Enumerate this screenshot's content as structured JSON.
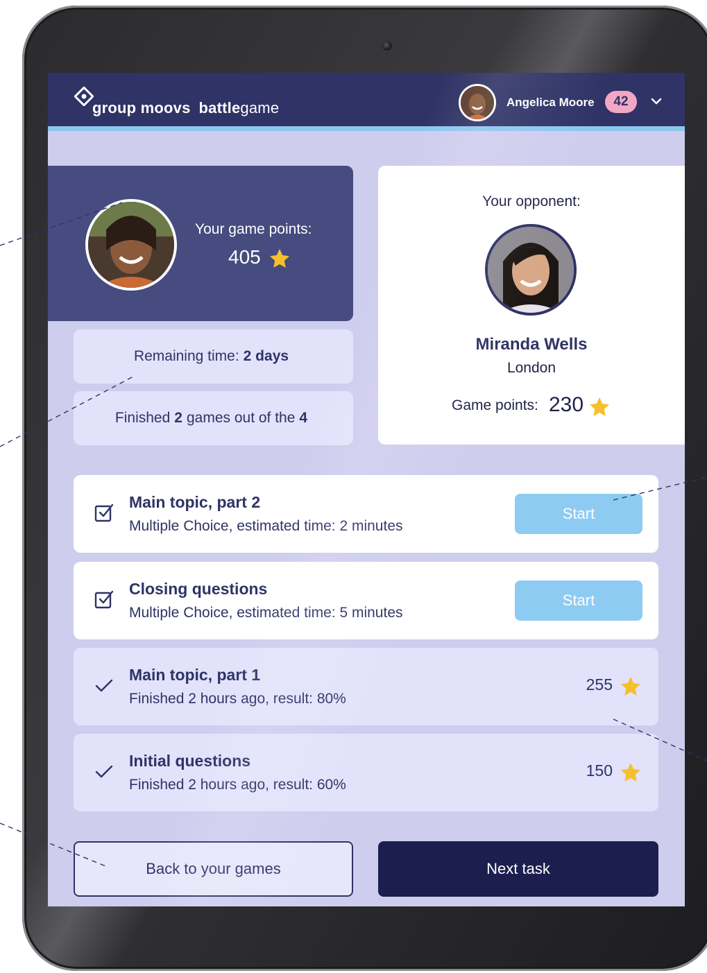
{
  "app": {
    "brand": "group moovs",
    "product_bold": "battle",
    "product_light": "game"
  },
  "header": {
    "username": "Angelica Moore",
    "badge_count": "42"
  },
  "player": {
    "points_label": "Your game points:",
    "points_value": "405"
  },
  "status": {
    "remaining_prefix": "Remaining time:",
    "remaining_value": "2 days",
    "finished_prefix": "Finished",
    "finished_count": "2",
    "finished_middle": "games out of the",
    "finished_total": "4"
  },
  "opponent": {
    "label": "Your opponent:",
    "name": "Miranda Wells",
    "city": "London",
    "points_label": "Game points:",
    "points_value": "230"
  },
  "tasks": [
    {
      "title": "Main topic, part 2",
      "subtitle": "Multiple Choice, estimated time: 2 minutes",
      "action_label": "Start",
      "state": "open"
    },
    {
      "title": "Closing questions",
      "subtitle": "Multiple Choice, estimated time: 5 minutes",
      "action_label": "Start",
      "state": "open"
    },
    {
      "title": "Main topic, part 1",
      "subtitle": "Finished 2 hours ago, result: 80%",
      "points": "255",
      "state": "done"
    },
    {
      "title": "Initial questions",
      "subtitle": "Finished 2 hours ago, result: 60%",
      "points": "150",
      "state": "done"
    }
  ],
  "footer": {
    "back_label": "Back to your games",
    "next_label": "Next task"
  },
  "colors": {
    "navy": "#2f3366",
    "card_dark": "#464c7f",
    "screen_bg": "#cfcdee",
    "start_button": "#8ecbf2",
    "star": "#f5c02e",
    "badge": "#f2a7c4"
  }
}
